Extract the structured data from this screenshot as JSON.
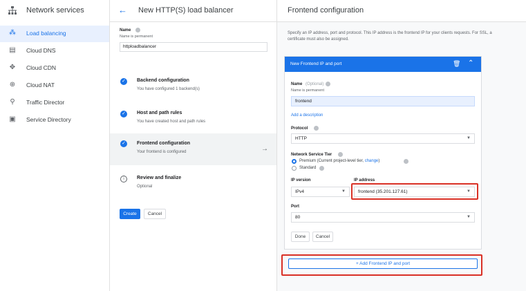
{
  "nav": {
    "title": "Network services",
    "items": [
      {
        "label": "Load balancing",
        "icon": "load-balancing-icon",
        "active": true
      },
      {
        "label": "Cloud DNS",
        "icon": "dns-icon"
      },
      {
        "label": "Cloud CDN",
        "icon": "cdn-icon"
      },
      {
        "label": "Cloud NAT",
        "icon": "nat-icon"
      },
      {
        "label": "Traffic Director",
        "icon": "traffic-director-icon"
      },
      {
        "label": "Service Directory",
        "icon": "service-directory-icon"
      }
    ]
  },
  "middle": {
    "title": "New HTTP(S) load balancer",
    "name_label": "Name",
    "name_help": "Name is permanent",
    "name_value": "httploadbalancer",
    "steps": [
      {
        "title": "Backend configuration",
        "sub": "You have configured 1 backend(s)"
      },
      {
        "title": "Host and path rules",
        "sub": "You have created host and path rules"
      },
      {
        "title": "Frontend configuration",
        "sub": "Your frontend is configured"
      },
      {
        "title": "Review and finalize",
        "sub": "Optional"
      }
    ],
    "create_label": "Create",
    "cancel_label": "Cancel"
  },
  "right": {
    "title": "Frontend configuration",
    "description": "Specify an IP address, port and protocol. This IP address is the frontend IP for your clients requests. For SSL, a certificate must also be assigned.",
    "card": {
      "title": "New Frontend IP and port",
      "name_label": "Name",
      "name_optional": "(Optional)",
      "name_help": "Name is permanent",
      "name_value": "frontend",
      "add_description": "Add a description",
      "protocol_label": "Protocol",
      "protocol_value": "HTTP",
      "tier_label": "Network Service Tier",
      "tier_premium": "Premium (Current project-level tier,",
      "tier_change": "change",
      "tier_premium_close": ")",
      "tier_standard": "Standard",
      "ipver_label": "IP version",
      "ipver_value": "IPv4",
      "ipaddr_label": "IP address",
      "ipaddr_value": "frontend (35.201.127.61)",
      "port_label": "Port",
      "port_value": "80",
      "done_label": "Done",
      "cancel_label": "Cancel"
    },
    "add_button": "+ Add Frontend IP and port"
  },
  "colors": {
    "accent": "#1a73e8",
    "highlight": "#d93025"
  }
}
